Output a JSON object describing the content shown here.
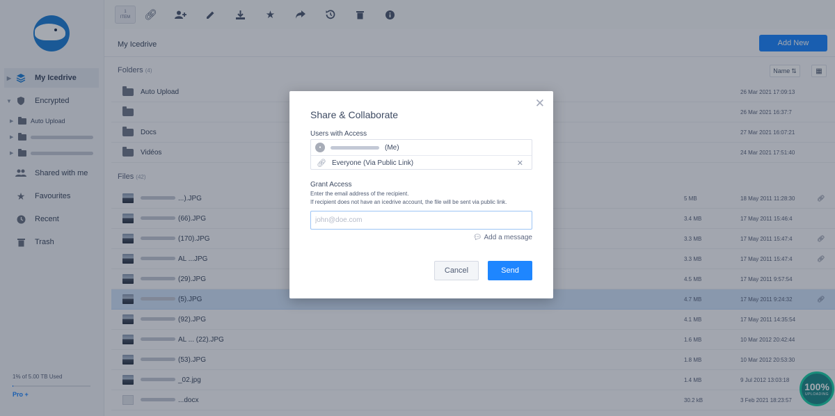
{
  "sidebar": {
    "items": [
      {
        "label": "My Icedrive",
        "icon": "layers-icon"
      },
      {
        "label": "Encrypted",
        "icon": "shield-icon"
      },
      {
        "label": "Auto Upload",
        "icon": "folder-icon"
      },
      {
        "label": "Shared with me",
        "icon": "users-icon"
      },
      {
        "label": "Favourites",
        "icon": "star-icon"
      },
      {
        "label": "Recent",
        "icon": "clock-icon"
      },
      {
        "label": "Trash",
        "icon": "trash-icon"
      }
    ],
    "usage_text": "1% of 5.00 TB Used",
    "usage_fraction": 0.01,
    "pro_link": "Pro +"
  },
  "toolbar": {
    "item_count": "1",
    "item_label": "ITEM",
    "tools": [
      "link-icon",
      "add-user-icon",
      "pencil-icon",
      "download-icon",
      "star-icon",
      "share-icon",
      "history-icon",
      "trash-icon",
      "info-icon"
    ]
  },
  "header": {
    "breadcrumb": "My Icedrive",
    "add_new": "Add New"
  },
  "folders": {
    "label": "Folders",
    "count": "(4)",
    "sort_label": "Name",
    "rows": [
      {
        "name": "Auto Upload",
        "date": "26 Mar 2021 17:09:13"
      },
      {
        "name": "",
        "date": "26 Mar 2021 16:37:7"
      },
      {
        "name": "Docs",
        "date": "27 Mar 2021 16:07:21"
      },
      {
        "name": "Vidéos",
        "date": "24 Mar 2021 17:51:40"
      }
    ]
  },
  "files": {
    "label": "Files",
    "count": "(42)",
    "rows": [
      {
        "name": "...).JPG",
        "size": "5 MB",
        "date": "18 May 2011 11:28:30"
      },
      {
        "name": "(66).JPG",
        "size": "3.4 MB",
        "date": "17 May 2011 15:46:4"
      },
      {
        "name": "(170).JPG",
        "size": "3.3 MB",
        "date": "17 May 2011 15:47:4"
      },
      {
        "name": "AL ...JPG",
        "size": "3.3 MB",
        "date": "17 May 2011 15:47:4"
      },
      {
        "name": "(29).JPG",
        "size": "4.5 MB",
        "date": "17 May 2011 9:57:54"
      },
      {
        "name": "(5).JPG",
        "size": "4.7 MB",
        "date": "17 May 2011 9:24:32"
      },
      {
        "name": "(92).JPG",
        "size": "4.1 MB",
        "date": "17 May 2011 14:35:54"
      },
      {
        "name": "AL ... (22).JPG",
        "size": "1.6 MB",
        "date": "10 Mar 2012 20:42:44"
      },
      {
        "name": "(53).JPG",
        "size": "1.8 MB",
        "date": "10 Mar 2012 20:53:30"
      },
      {
        "name": "_02.jpg",
        "size": "1.4 MB",
        "date": "9 Jul 2012 13:03:18"
      },
      {
        "name": "...docx",
        "size": "30.2 kB",
        "date": "3 Feb 2021 18:23:57"
      }
    ]
  },
  "upload": {
    "percent": "100%",
    "label": "UPLOADING"
  },
  "modal": {
    "title": "Share & Collaborate",
    "users_label": "Users with Access",
    "me_suffix": "(Me)",
    "everyone_label": "Everyone (Via Public Link)",
    "grant_label": "Grant Access",
    "hint1": "Enter the email address of the recipient.",
    "hint2": "If recipient does not have an icedrive account, the file will be sent via public link.",
    "email_placeholder": "john@doe.com",
    "add_message": "Add a message",
    "cancel": "Cancel",
    "send": "Send"
  },
  "colors": {
    "accent": "#1e86ff",
    "selected_row": "#d2e4fb",
    "upload_ring": "#1dd0a8"
  }
}
